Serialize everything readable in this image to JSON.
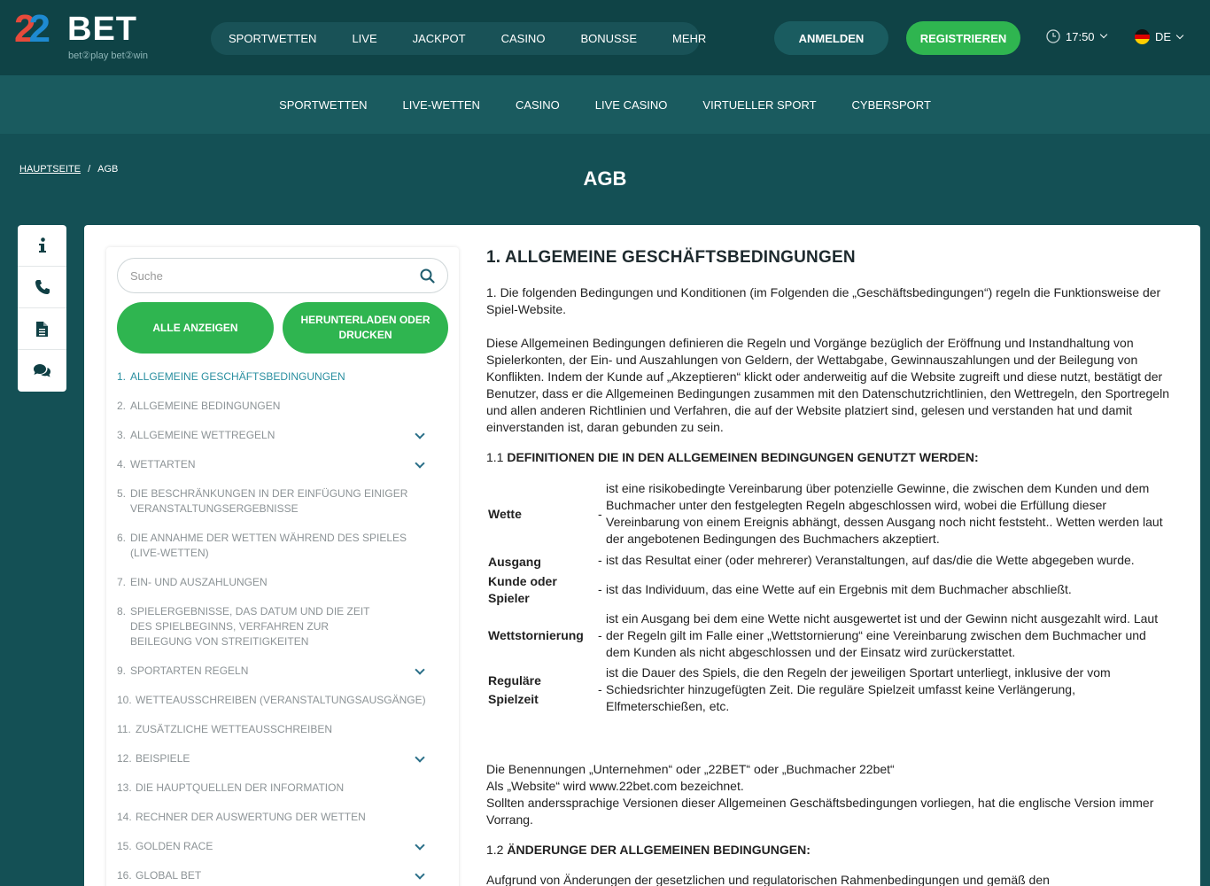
{
  "header": {
    "logo": {
      "num1": "2",
      "num2": "2",
      "brand": "BET",
      "tagline": "bet②play  bet②win"
    },
    "nav": [
      "SPORTWETTEN",
      "LIVE",
      "JACKPOT",
      "CASINO",
      "BONUSSE",
      "MEHR"
    ],
    "login_label": "ANMELDEN",
    "register_label": "REGISTRIEREN",
    "time": "17:50",
    "language": "DE"
  },
  "subnav": [
    "SPORTWETTEN",
    "LIVE-WETTEN",
    "CASINO",
    "LIVE CASINO",
    "VIRTUELLER SPORT",
    "CYBERSPORT"
  ],
  "breadcrumb": {
    "home": "HAUPTSEITE",
    "separator": "/",
    "current": "AGB"
  },
  "page_title": "AGB",
  "side_icons": [
    "info-icon",
    "phone-icon",
    "document-icon",
    "chat-icon"
  ],
  "toc": {
    "search_placeholder": "Suche",
    "show_all_label": "ALLE ANZEIGEN",
    "download_label": "HERUNTERLADEN ODER DRUCKEN",
    "items": [
      {
        "num": "1.",
        "label": "ALLGEMEINE GESCHÄFTSBEDINGUNGEN",
        "active": true,
        "expandable": false
      },
      {
        "num": "2.",
        "label": "ALLGEMEINE BEDINGUNGEN",
        "expandable": false
      },
      {
        "num": "3.",
        "label": "ALLGEMEINE WETTREGELN",
        "expandable": true
      },
      {
        "num": "4.",
        "label": "WETTARTEN",
        "expandable": true
      },
      {
        "num": "5.",
        "label": "DIE BESCHRÄNKUNGEN IN DER EINFÜGUNG EINIGER VERANSTALTUNGSERGEBNISSE",
        "expandable": false
      },
      {
        "num": "6.",
        "label": "DIE ANNAHME DER WETTEN WÄHREND DES SPIELES (LIVE-WETTEN)",
        "expandable": false
      },
      {
        "num": "7.",
        "label": "EIN- UND AUSZAHLUNGEN",
        "expandable": false
      },
      {
        "num": "8.",
        "label": "SPIELERGEBNISSE, DAS DATUM UND DIE ZEIT DES SPIELBEGINNS, VERFAHREN ZUR BEILEGUNG VON STREITIGKEITEN",
        "expandable": false
      },
      {
        "num": "9.",
        "label": "SPORTARTEN REGELN",
        "expandable": true
      },
      {
        "num": "10.",
        "label": "WETTEAUSSCHREIBEN (VERANSTALTUNGSAUSGÄNGE)",
        "expandable": false
      },
      {
        "num": "11.",
        "label": "ZUSÄTZLICHE WETTEAUSSCHREIBEN",
        "expandable": false
      },
      {
        "num": "12.",
        "label": "BEISPIELE",
        "expandable": true
      },
      {
        "num": "13.",
        "label": "DIE HAUPTQUELLEN DER INFORMATION",
        "expandable": false
      },
      {
        "num": "14.",
        "label": "RECHNER DER AUSWERTUNG DER WETTEN",
        "expandable": false
      },
      {
        "num": "15.",
        "label": "GOLDEN RACE",
        "expandable": true
      },
      {
        "num": "16.",
        "label": "GLOBAL BET",
        "expandable": true
      }
    ]
  },
  "content": {
    "title": "1. ALLGEMEINE GESCHÄFTSBEDINGUNGEN",
    "p1": "1. Die folgenden Bedingungen und Konditionen (im Folgenden die „Geschäftsbedingungen“) regeln die Funktionsweise der Spiel-Website.",
    "p2": "Diese Allgemeinen Bedingungen definieren die Regeln und Vorgänge bezüglich der Eröffnung und Instandhaltung von Spielerkonten, der Ein- und Auszahlungen von Geldern, der Wettabgabe, Gewinnauszahlungen und der Beilegung von Konflikten. Indem der Kunde auf „Akzeptieren“ klickt oder anderweitig auf die Website zugreift und diese nutzt, bestätigt der Benutzer, dass er die Allgemeinen Bedingungen zusammen mit den Datenschutzrichtlinien, den Wettregeln, den Sportregeln und allen anderen Richtlinien und Verfahren, die auf der Website platziert sind, gelesen und verstanden hat und damit einverstanden ist, daran gebunden zu sein.",
    "h11_num": "1.1",
    "h11": "DEFINITIONEN DIE IN DEN ALLGEMEINEN BEDINGUNGEN GENUTZT WERDEN:",
    "definitions": [
      {
        "term": "Wette",
        "dash": "-",
        "desc": "ist eine risikobedingte Vereinbarung über potenzielle Gewinne, die zwischen dem Kunden und dem Buchmacher unter den festgelegten Regeln abgeschlossen wird, wobei die Erfüllung dieser Vereinbarung von einem Ereignis abhängt, dessen Ausgang noch nicht feststeht.. Wetten werden laut der angebotenen Bedingungen des Buchmachers akzeptiert."
      },
      {
        "term": "Ausgang",
        "dash": "-",
        "desc": "ist das Resultat einer (oder mehrerer) Veranstaltungen, auf das/die die Wette abgegeben wurde."
      },
      {
        "term": "Kunde oder Spieler",
        "dash": "-",
        "desc": "ist das Individuum, das eine Wette auf ein Ergebnis mit dem Buchmacher abschließt."
      },
      {
        "term": "Wettstornierung",
        "dash": "-",
        "desc": "ist ein Ausgang bei dem eine Wette nicht ausgewertet ist und der Gewinn nicht ausgezahlt wird. Laut der Regeln gilt im Falle einer „Wettstornierung“ eine Vereinbarung zwischen dem Buchmacher und dem Kunden als nicht abgeschlossen und der Einsatz wird zurückerstattet."
      },
      {
        "term": "Reguläre Spielzeit",
        "dash": "-",
        "desc": "ist die Dauer des Spiels, die den Regeln der jeweiligen Sportart unterliegt, inklusive der vom Schiedsrichter hinzugefügten Zeit. Die reguläre Spielzeit umfasst keine Verlängerung, Elfmeterschießen, etc."
      }
    ],
    "p3_line1": "Die Benennungen „Unternehmen“ oder „22BET“ oder „Buchmacher 22bet“",
    "p3_line2": "Als „Website“ wird www.22bet.com bezeichnet.",
    "p3_line3": "Sollten anderssprachige Versionen dieser Allgemeinen Geschäftsbedingungen vorliegen, hat die englische Version immer Vorrang.",
    "h12_num": "1.2",
    "h12": "ÄNDERUNGE DER ALLGEMEINEN BEDINGUNGEN:",
    "p4": "Aufgrund von Änderungen der gesetzlichen und regulatorischen Rahmenbedingungen und gemäß den"
  }
}
